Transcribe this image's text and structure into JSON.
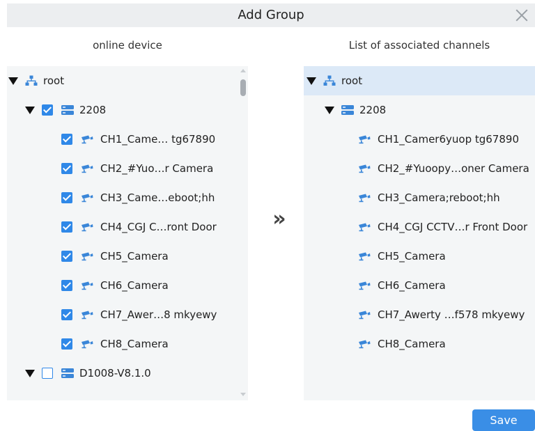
{
  "dialog": {
    "title": "Add Group",
    "save_label": "Save",
    "transfer_glyph": "»"
  },
  "left": {
    "title": "online device",
    "tree": {
      "root_label": "root",
      "device1": {
        "label": "2208",
        "checked": true,
        "channels": [
          {
            "label": "CH1_Came… tg67890",
            "checked": true
          },
          {
            "label": "CH2_#Yuo…r Camera",
            "checked": true
          },
          {
            "label": "CH3_Came…eboot;hh",
            "checked": true
          },
          {
            "label": "CH4_CGJ C…ront Door",
            "checked": true
          },
          {
            "label": "CH5_Camera",
            "checked": true
          },
          {
            "label": "CH6_Camera",
            "checked": true
          },
          {
            "label": "CH7_Awer…8 mkyewy",
            "checked": true
          },
          {
            "label": "CH8_Camera",
            "checked": true
          }
        ]
      },
      "device2": {
        "label": "D1008-V8.1.0",
        "checked": false
      }
    }
  },
  "right": {
    "title": "List of associated channels",
    "tree": {
      "root_label": "root",
      "device1": {
        "label": "2208",
        "channels": [
          "CH1_Camer6yuop tg67890",
          "CH2_#Yuoopy…oner Camera",
          "CH3_Camera;reboot;hh",
          "CH4_CGJ CCTV…r Front Door",
          "CH5_Camera",
          "CH6_Camera",
          "CH7_Awerty …f578 mkyewy",
          "CH8_Camera"
        ]
      }
    }
  },
  "colors": {
    "accent": "#2f88e8",
    "icon_blue": "#3a86d8",
    "panel_bg": "#f4f6f7",
    "selected_row": "#dce9f7",
    "titlebar_bg": "#eceef0"
  },
  "icons": {
    "root": "network-tree-icon",
    "device": "server-icon",
    "channel": "camera-icon",
    "expand": "caret-down-icon",
    "close": "close-icon",
    "transfer": "double-chevron-right-icon"
  }
}
